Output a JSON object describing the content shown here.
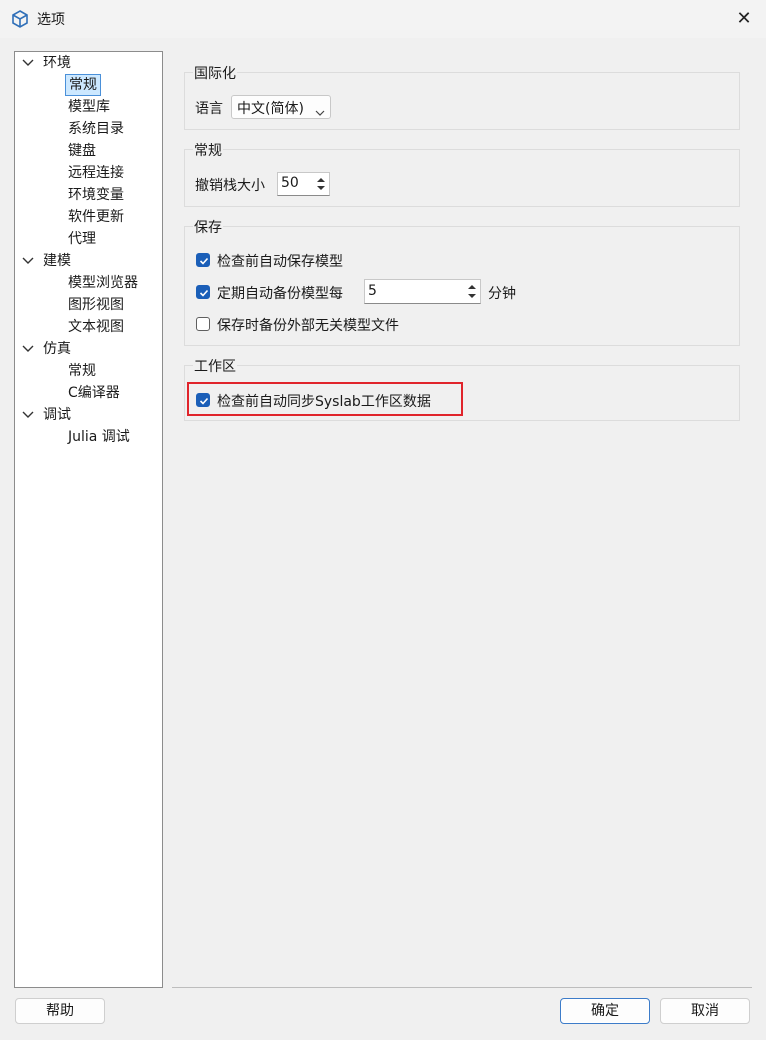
{
  "window": {
    "title": "选项",
    "close_icon": "close-icon"
  },
  "tree": {
    "nodes": [
      {
        "label": "环境",
        "expanded": true
      },
      {
        "label": "常规",
        "selected": true
      },
      {
        "label": "模型库"
      },
      {
        "label": "系统目录"
      },
      {
        "label": "键盘"
      },
      {
        "label": "远程连接"
      },
      {
        "label": "环境变量"
      },
      {
        "label": "软件更新"
      },
      {
        "label": "代理"
      },
      {
        "label": "建模",
        "expanded": true
      },
      {
        "label": "模型浏览器"
      },
      {
        "label": "图形视图"
      },
      {
        "label": "文本视图"
      },
      {
        "label": "仿真",
        "expanded": true
      },
      {
        "label": "常规"
      },
      {
        "label": "C编译器"
      },
      {
        "label": "调试",
        "expanded": true
      },
      {
        "label": "Julia 调试"
      }
    ]
  },
  "intl": {
    "group_title": "国际化",
    "language_label": "语言",
    "language_value": "中文(简体)"
  },
  "general": {
    "group_title": "常规",
    "undo_label": "撤销栈大小",
    "undo_value": "50"
  },
  "save": {
    "group_title": "保存",
    "auto_save_label": "检查前自动保存模型",
    "auto_save_checked": true,
    "backup_label": "定期自动备份模型每",
    "backup_checked": true,
    "backup_value": "5",
    "backup_unit": "分钟",
    "external_label": "保存时备份外部无关模型文件",
    "external_checked": false
  },
  "workspace": {
    "group_title": "工作区",
    "sync_label": "检查前自动同步Syslab工作区数据",
    "sync_checked": true
  },
  "footer": {
    "help_label": "帮助",
    "ok_label": "确定",
    "cancel_label": "取消"
  },
  "colors": {
    "accent": "#1b5fb8",
    "selection": "#cce8ff",
    "highlight": "#e0242b"
  }
}
